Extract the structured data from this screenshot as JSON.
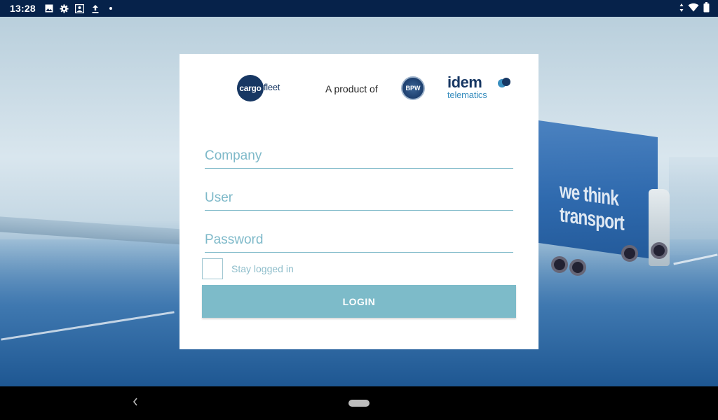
{
  "status_bar": {
    "time": "13:28",
    "icons": [
      "image-icon",
      "settings-icon",
      "contact-icon",
      "upload-icon",
      "dot-icon"
    ],
    "right_icons": [
      "data-arrows-icon",
      "wifi-icon",
      "battery-icon"
    ]
  },
  "background": {
    "truck_text": "we think transport"
  },
  "logos": {
    "cargo": "cargo",
    "fleet": "fleet",
    "product_of": "A product of",
    "bpw": "BPW",
    "idem": "idem",
    "telematics": "telematics"
  },
  "form": {
    "company_placeholder": "Company",
    "user_placeholder": "User",
    "password_placeholder": "Password",
    "stay_logged_in_label": "Stay logged in",
    "stay_logged_in_checked": false,
    "login_label": "LOGIN"
  },
  "colors": {
    "accent": "#7dbbc9",
    "status_bar": "#06224a",
    "brand_navy": "#173763"
  }
}
